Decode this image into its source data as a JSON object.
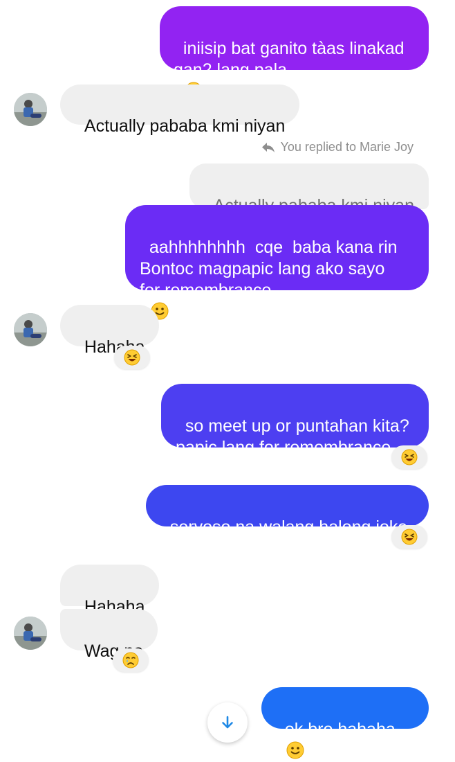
{
  "colors": {
    "sent_purple": "#9223f2",
    "sent_violet": "#6b2cf5",
    "sent_indigo": "#4d3ff1",
    "sent_blue": "#3d47f0",
    "sent_royal": "#2d57f2",
    "sent_sky": "#1e6ff6",
    "received_bubble": "#efefef",
    "scroll_arrow": "#1e88e5"
  },
  "messages": [
    {
      "id": "m1",
      "direction": "outgoing",
      "text": "iniisip bat ganito tàas linakad\ngan2 lang pala",
      "trailing_emoji": "rolling-on-floor-laughing-emoji"
    },
    {
      "id": "m2",
      "direction": "incoming",
      "text": "Actually pababa kmi niyan"
    },
    {
      "id": "m3",
      "direction": "outgoing",
      "reply_label": "You replied to Marie Joy",
      "quoted_text": "Actually pababa kmi niyan",
      "text": "aahhhhhhhh  cqe  baba kana rin\nBontoc magpapic lang ako sayo\nfor remembrance",
      "trailing_emoji": "slightly-smiling-emoji"
    },
    {
      "id": "m4",
      "direction": "incoming",
      "text": "Hahaha",
      "reaction": "laughing-emoji"
    },
    {
      "id": "m5",
      "direction": "outgoing",
      "text": "so meet up or puntahan kita?\npapic lang for remembrance",
      "reaction": "laughing-emoji"
    },
    {
      "id": "m6",
      "direction": "outgoing",
      "text": "seryoso na walang halong joke",
      "reaction": "laughing-emoji"
    },
    {
      "id": "m7",
      "direction": "incoming",
      "text": "Hahaha"
    },
    {
      "id": "m8",
      "direction": "incoming",
      "text": "Wag na",
      "reaction": "crying-emoji"
    },
    {
      "id": "m9",
      "direction": "outgoing",
      "text": "ok bro hahaha",
      "trailing_emoji": "slightly-smiling-emoji"
    }
  ],
  "scroll_button": {
    "icon": "arrow-down-icon"
  }
}
